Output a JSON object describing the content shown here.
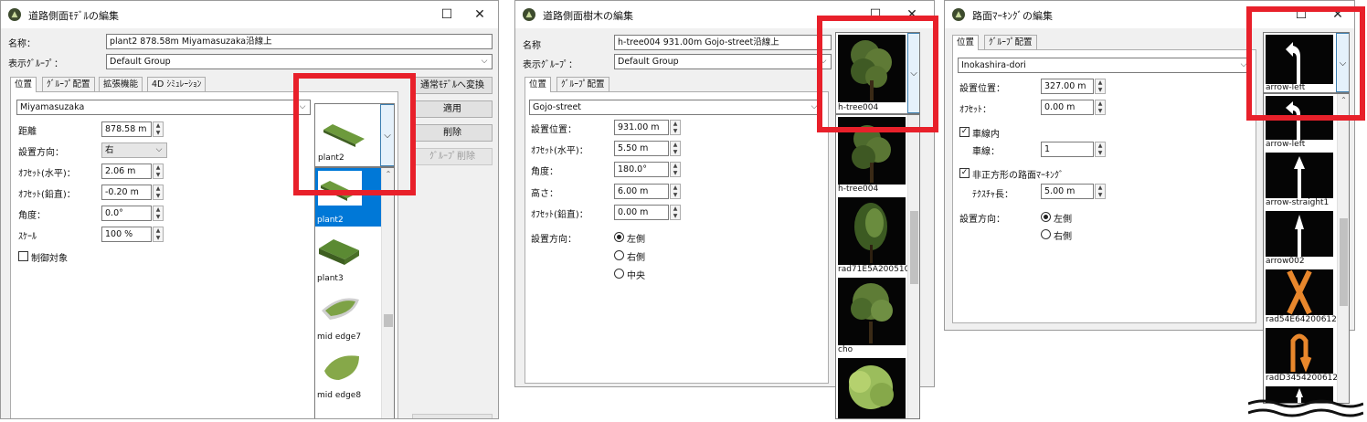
{
  "window1": {
    "title": "道路側面ﾓﾃﾞﾙの編集",
    "name_label": "名称：",
    "name_value": "plant2 878.58m Miyamasuzaka沿線上",
    "group_label": "表示ｸﾞﾙｰﾌﾟ：",
    "group_value": "Default Group",
    "tabs": [
      "位置",
      "ｸﾞﾙｰﾌﾟ配置",
      "拡張機能",
      "4D ｼﾐｭﾚｰｼｮﾝ"
    ],
    "road_value": "Miyamasuzaka",
    "fields": [
      {
        "label": "距離",
        "value": "878.58 m"
      },
      {
        "label": "設置方向：",
        "value": "右"
      },
      {
        "label": "ｵﾌｾｯﾄ(水平)：",
        "value": "2.06 m"
      },
      {
        "label": "ｵﾌｾｯﾄ(鉛直)：",
        "value": "-0.20 m"
      },
      {
        "label": "角度：",
        "value": "0.0°"
      },
      {
        "label": "ｽｹｰﾙ",
        "value": "100 %"
      }
    ],
    "control_label": "制御対象",
    "buttons": [
      "通常ﾓﾃﾞﾙへ変換",
      "適用",
      "削除",
      "ｸﾞﾙｰﾌﾟ削除"
    ],
    "model_selected": "plant2",
    "model_items": [
      "plant2",
      "plant3",
      "mid edge7",
      "mid edge8"
    ]
  },
  "window2": {
    "title": "道路側面樹木の編集",
    "name_label": "名称",
    "name_value": "h-tree004 931.00m Gojo-street沿線上",
    "group_label": "表示ｸﾞﾙｰﾌﾟ：",
    "group_value": "Default Group",
    "tabs": [
      "位置",
      "ｸﾞﾙｰﾌﾟ配置"
    ],
    "road_value": "Gojo-street",
    "fields": [
      {
        "label": "設置位置：",
        "value": "931.00 m"
      },
      {
        "label": "ｵﾌｾｯﾄ(水平)：",
        "value": "5.50 m"
      },
      {
        "label": "角度：",
        "value": "180.0°"
      },
      {
        "label": "高さ：",
        "value": "6.00 m"
      },
      {
        "label": "ｵﾌｾｯﾄ(鉛直)：",
        "value": "0.00 m"
      }
    ],
    "direction_label": "設置方向：",
    "directions": [
      "左側",
      "右側",
      "中央"
    ],
    "tree_selected": "h-tree004",
    "tree_items": [
      "h-tree004",
      "rad71E5A200510",
      "cho"
    ]
  },
  "window3": {
    "title": "路面ﾏｰｷﾝｸﾞの編集",
    "tabs": [
      "位置",
      "ｸﾞﾙｰﾌﾟ配置"
    ],
    "road_value": "Inokashira-dori",
    "pos_label": "設置位置：",
    "pos_value": "327.00 m",
    "offset_label": "ｵﾌｾｯﾄ：",
    "offset_value": "0.00 m",
    "inlane_label": "車線内",
    "lane_label": "車線：",
    "lane_value": "1",
    "nonrect_label": "非正方形の路面ﾏｰｷﾝｸﾞ",
    "texture_label": "ﾃｸｽﾁｬ長：",
    "texture_value": "5.00 m",
    "direction_label": "設置方向：",
    "directions": [
      "左側",
      "右側"
    ],
    "marking_selected": "arrow-left",
    "marking_items": [
      "arrow-left",
      "arrow-straight1",
      "arrow002",
      "rad54E64200612...",
      "radD3454200612..."
    ]
  },
  "colors": {
    "highlight": "#e8202a",
    "selection": "#0078d7",
    "marking_orange": "#e8872c"
  }
}
